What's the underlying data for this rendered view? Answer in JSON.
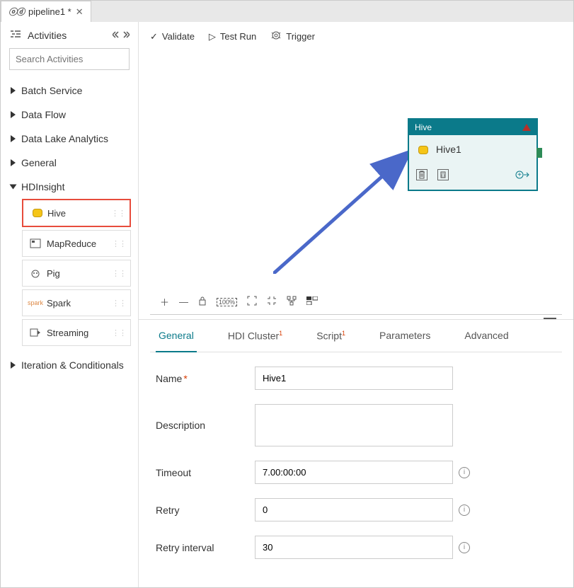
{
  "tab": {
    "title": "pipeline1 *",
    "icon": "pipeline-icon"
  },
  "sidebar": {
    "title": "Activities",
    "chevrons": "«  »",
    "search_placeholder": "Search Activities",
    "categories": [
      {
        "label": "Batch Service",
        "expanded": false
      },
      {
        "label": "Data Flow",
        "expanded": false
      },
      {
        "label": "Data Lake Analytics",
        "expanded": false
      },
      {
        "label": "General",
        "expanded": false
      },
      {
        "label": "HDInsight",
        "expanded": true,
        "items": [
          {
            "label": "Hive",
            "icon": "hive-icon"
          },
          {
            "label": "MapReduce",
            "icon": "mapreduce-icon"
          },
          {
            "label": "Pig",
            "icon": "pig-icon"
          },
          {
            "label": "Spark",
            "icon": "spark-icon"
          },
          {
            "label": "Streaming",
            "icon": "streaming-icon"
          }
        ]
      },
      {
        "label": "Iteration & Conditionals",
        "expanded": false
      }
    ]
  },
  "actions": {
    "validate": "Validate",
    "test_run": "Test Run",
    "trigger": "Trigger"
  },
  "node": {
    "type": "Hive",
    "name": "Hive1"
  },
  "prop": {
    "tabs": [
      "General",
      "HDI Cluster",
      "Script",
      "Parameters",
      "Advanced"
    ],
    "tab_badges": {
      "HDI Cluster": "1",
      "Script": "1"
    },
    "name_label": "Name",
    "name_value": "Hive1",
    "desc_label": "Description",
    "desc_value": "",
    "timeout_label": "Timeout",
    "timeout_value": "7.00:00:00",
    "retry_label": "Retry",
    "retry_value": "0",
    "retryint_label": "Retry interval",
    "retryint_value": "30"
  }
}
